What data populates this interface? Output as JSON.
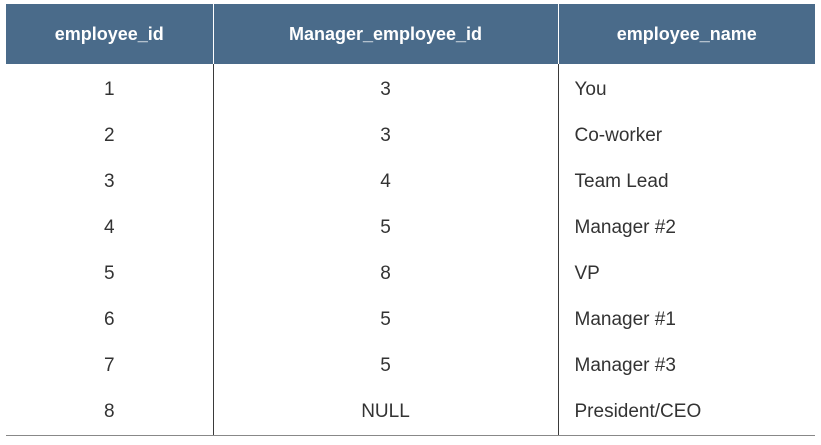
{
  "table": {
    "headers": [
      "employee_id",
      "Manager_employee_id",
      "employee_name"
    ],
    "rows": [
      [
        "1",
        "3",
        "You"
      ],
      [
        "2",
        "3",
        "Co-worker"
      ],
      [
        "3",
        "4",
        "Team Lead"
      ],
      [
        "4",
        "5",
        "Manager #2"
      ],
      [
        "5",
        "8",
        "VP"
      ],
      [
        "6",
        "5",
        "Manager #1"
      ],
      [
        "7",
        "5",
        "Manager #3"
      ],
      [
        "8",
        "NULL",
        "President/CEO"
      ]
    ],
    "colors": {
      "header_bg": "#4a6b8a",
      "header_text": "#ffffff",
      "body_text": "#333333"
    }
  }
}
